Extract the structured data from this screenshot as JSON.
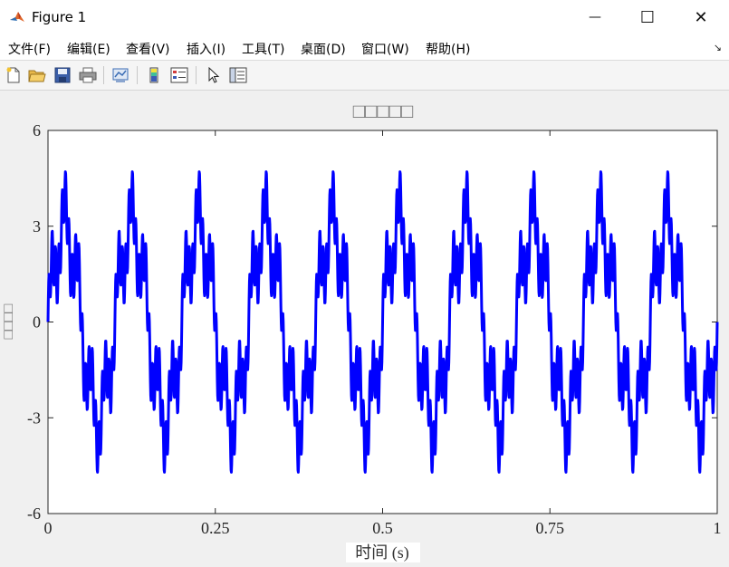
{
  "window": {
    "title": "Figure 1",
    "minimize_glyph": "—",
    "maximize_glyph": "☐",
    "close_glyph": "✕"
  },
  "menu": {
    "items": [
      "文件(F)",
      "编辑(E)",
      "查看(V)",
      "插入(I)",
      "工具(T)",
      "桌面(D)",
      "窗口(W)",
      "帮助(H)"
    ],
    "overflow_glyph": "↘"
  },
  "toolbar": {
    "icons": [
      "new-figure-icon",
      "open-file-icon",
      "save-icon",
      "print-icon",
      "link-plot-icon",
      "insert-colorbar-icon",
      "insert-legend-icon",
      "edit-plot-arrow-icon",
      "property-inspector-icon"
    ]
  },
  "chart_data": {
    "type": "line",
    "title": "□□□□□",
    "xlabel": "时间 (s)",
    "ylabel": "□□□□",
    "xlim": [
      0,
      1
    ],
    "ylim": [
      -6,
      6
    ],
    "xticks": [
      0,
      0.25,
      0.5,
      0.75,
      1
    ],
    "xtick_labels": [
      "0",
      "0.25",
      "0.5",
      "0.75",
      "1"
    ],
    "yticks": [
      6,
      3,
      0,
      -3,
      -6
    ],
    "ytick_labels": [
      "6",
      "3",
      "0",
      "-3",
      "-6"
    ],
    "grid": false,
    "series": [
      {
        "color": "#0000ff",
        "sample_points": 2000,
        "components": [
          {
            "amplitude": 3,
            "frequency_hz": 10,
            "phase": 0
          },
          {
            "amplitude": 1,
            "frequency_hz": 50,
            "phase": 0
          },
          {
            "amplitude": 0.8,
            "frequency_hz": 200,
            "phase": 0
          }
        ],
        "peak": 4.8,
        "trough": -4.8
      }
    ]
  }
}
